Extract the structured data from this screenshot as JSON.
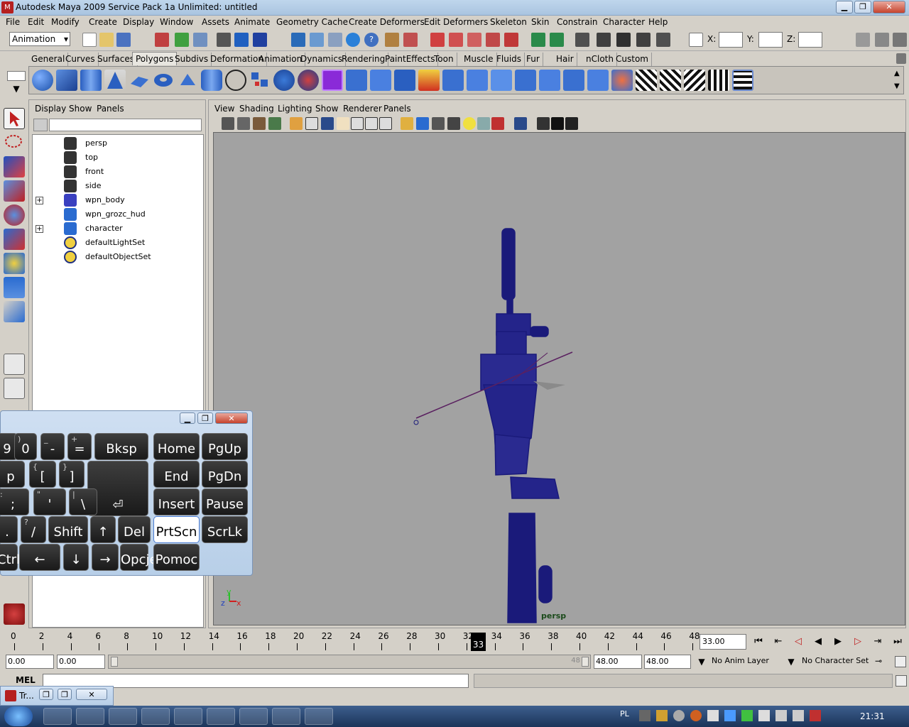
{
  "window": {
    "title": "Autodesk Maya 2009 Service Pack 1a Unlimited: untitled"
  },
  "menubar": [
    "File",
    "Edit",
    "Modify",
    "Create",
    "Display",
    "Window",
    "Assets",
    "Animate",
    "Geometry Cache",
    "Create Deformers",
    "Edit Deformers",
    "Skeleton",
    "Skin",
    "Constrain",
    "Character",
    "Help"
  ],
  "statusline": {
    "mode": "Animation",
    "x_label": "X:",
    "y_label": "Y:",
    "z_label": "Z:"
  },
  "shelf_tabs": [
    "General",
    "Curves",
    "Surfaces",
    "Polygons",
    "Subdivs",
    "Deformation",
    "Animation",
    "Dynamics",
    "Rendering",
    "PaintEffects",
    "Toon",
    "Muscle",
    "Fluids",
    "Fur",
    "Hair",
    "nCloth",
    "Custom"
  ],
  "shelf_active": "Polygons",
  "outliner": {
    "menu": [
      "Display",
      "Show",
      "Panels"
    ],
    "items": [
      {
        "label": "persp",
        "icon": "camera-icon",
        "expandable": false
      },
      {
        "label": "top",
        "icon": "camera-icon",
        "expandable": false
      },
      {
        "label": "front",
        "icon": "camera-icon",
        "expandable": false
      },
      {
        "label": "side",
        "icon": "camera-icon",
        "expandable": false
      },
      {
        "label": "wpn_body",
        "icon": "joint-icon",
        "expandable": true
      },
      {
        "label": "wpn_grozc_hud",
        "icon": "mesh-icon",
        "expandable": false
      },
      {
        "label": "character",
        "icon": "character-icon",
        "expandable": true
      },
      {
        "label": "defaultLightSet",
        "icon": "set-icon",
        "expandable": false
      },
      {
        "label": "defaultObjectSet",
        "icon": "set-icon",
        "expandable": false
      }
    ]
  },
  "viewport": {
    "menu": [
      "View",
      "Shading",
      "Lighting",
      "Show",
      "Renderer",
      "Panels"
    ],
    "camera_label": "persp",
    "axis": {
      "x": "x",
      "y": "y",
      "z": "z"
    },
    "bg_color": "#a2a2a2",
    "wire_color": "#1a1a7a"
  },
  "timeline": {
    "ticks": [
      "0",
      "2",
      "4",
      "6",
      "8",
      "10",
      "12",
      "14",
      "16",
      "18",
      "20",
      "22",
      "24",
      "26",
      "28",
      "30",
      "32",
      "34",
      "36",
      "38",
      "40",
      "42",
      "44",
      "46",
      "48"
    ],
    "current_frame": "33",
    "current_time_field": "33.00",
    "range_start": "0.00",
    "range_start2": "0.00",
    "range_end": "48.00",
    "range_end2": "48.00",
    "range_marker": "48",
    "anim_layer": "No Anim Layer",
    "character_set": "No Character Set"
  },
  "cmdline": {
    "label": "MEL"
  },
  "osk": {
    "keys": [
      {
        "main": "9",
        "sup": "",
        "k": "k-9"
      },
      {
        "main": "0",
        "sup": ")",
        "k": "k-0"
      },
      {
        "main": "-",
        "sup": "_",
        "k": "k-minus"
      },
      {
        "main": "=",
        "sup": "+",
        "k": "k-eq"
      },
      {
        "main": "Bksp",
        "sup": "",
        "k": "k-bksp"
      },
      {
        "main": "Home",
        "sup": "",
        "k": "k-home"
      },
      {
        "main": "PgUp",
        "sup": "",
        "k": "k-pgup"
      },
      {
        "main": "p",
        "sup": "",
        "k": "k-p"
      },
      {
        "main": "[",
        "sup": "{",
        "k": "k-lbr"
      },
      {
        "main": "]",
        "sup": "}",
        "k": "k-rbr"
      },
      {
        "main": "⏎",
        "sup": "",
        "k": "k-enter"
      },
      {
        "main": "End",
        "sup": "",
        "k": "k-end"
      },
      {
        "main": "PgDn",
        "sup": "",
        "k": "k-pgdn"
      },
      {
        "main": ";",
        "sup": ":",
        "k": "k-semi"
      },
      {
        "main": "'",
        "sup": "\"",
        "k": "k-quote"
      },
      {
        "main": "\\",
        "sup": "|",
        "k": "k-bslash"
      },
      {
        "main": "Insert",
        "sup": "",
        "k": "k-insert"
      },
      {
        "main": "Pause",
        "sup": "",
        "k": "k-pause"
      },
      {
        "main": ".",
        "sup": "",
        "k": "k-dot"
      },
      {
        "main": "/",
        "sup": "?",
        "k": "k-slash"
      },
      {
        "main": "Shift",
        "sup": "",
        "k": "k-shift"
      },
      {
        "main": "↑",
        "sup": "",
        "k": "k-up"
      },
      {
        "main": "Del",
        "sup": "",
        "k": "k-del"
      },
      {
        "main": "PrtScn",
        "sup": "",
        "k": "k-prtscn"
      },
      {
        "main": "ScrLk",
        "sup": "",
        "k": "k-scrlk"
      },
      {
        "main": "Ctrl",
        "sup": "",
        "k": "k-ctrl"
      },
      {
        "main": "←",
        "sup": "",
        "k": "k-left"
      },
      {
        "main": "↓",
        "sup": "",
        "k": "k-down"
      },
      {
        "main": "→",
        "sup": "",
        "k": "k-right"
      },
      {
        "main": "Opcje",
        "sup": "",
        "k": "k-opcje"
      },
      {
        "main": "Pomoc",
        "sup": "",
        "k": "k-pomoc"
      }
    ]
  },
  "minitask": {
    "label": "Tr..."
  },
  "taskbar": {
    "lang": "PL",
    "clock": "21:31"
  }
}
